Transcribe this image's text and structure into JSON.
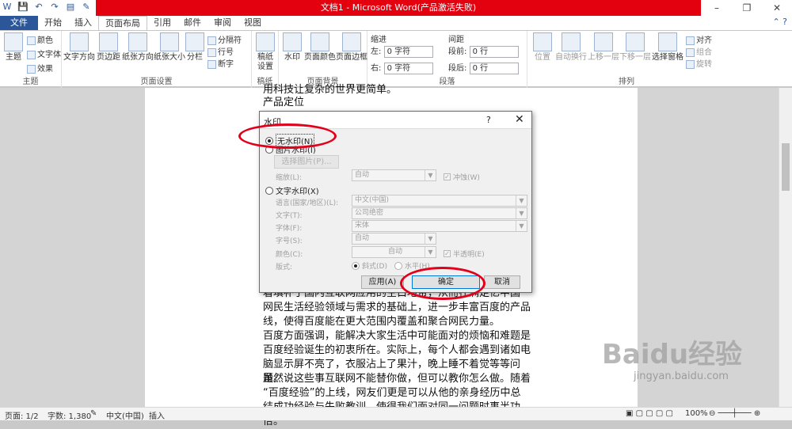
{
  "window": {
    "title": "文档1 - Microsoft Word(产品激活失败)"
  },
  "tabs": [
    "文件",
    "开始",
    "插入",
    "页面布局",
    "引用",
    "邮件",
    "审阅",
    "视图"
  ],
  "ribbon": {
    "theme": {
      "big": "主题",
      "colors": "颜色",
      "fonts": "文字体",
      "effects": "效果",
      "label": "主题"
    },
    "page_setup": {
      "buttons": [
        "文字方向",
        "页边距",
        "纸张方向",
        "纸张大小",
        "分栏"
      ],
      "breaks": "分隔符",
      "line_numbers": "行号",
      "hyphenation": "断字",
      "label": "页面设置"
    },
    "manuscript": {
      "button": "稿纸\n设置",
      "label": "稿纸"
    },
    "page_background": {
      "buttons": [
        "水印",
        "页面颜色",
        "页面边框"
      ],
      "label": "页面背景"
    },
    "paragraph": {
      "indent": "缩进",
      "spacing": "间距",
      "left": "左:",
      "right": "右:",
      "before": "段前:",
      "after": "段后:",
      "left_val": "0 字符",
      "right_val": "0 字符",
      "before_val": "0 行",
      "after_val": "0 行",
      "label": "段落"
    },
    "arrange": {
      "buttons": [
        "位置",
        "自动换行",
        "上移一层",
        "下移一层",
        "选择窗格"
      ],
      "align": "对齐",
      "group": "组合",
      "rotate": "旋转",
      "label": "排列"
    }
  },
  "document": {
    "top_lines": [
      "用科技让复杂的世界更简单。",
      "产品定位"
    ],
    "bottom_lines": [
      "着填补了国内互联网应用的空白地带，从而在满足亿中国",
      "网民生活经验领域与需求的基础上，进一步丰富百度的产品",
      "线，使得百度能在更大范围内覆盖和聚合网民力量。",
      "百度方面强调，能解决大家生活中可能面对的烦恼和难题是",
      "百度经验诞生的初衷所在。实际上，每个人都会遇到诸如电",
      "脑显示屏不亮了，衣服沾上了果汁，晚上睡不着觉等等问题。",
      "虽然说这些事互联网不能替你做，但可以教你怎么做。随着",
      "“百度经验”的上线，网友们更是可以从他的亲身经历中总",
      "结成功经验与失败教训，使得我们面对同一问题时事半功倍。"
    ]
  },
  "dialog": {
    "title": "水印",
    "help": "?",
    "close": "✕",
    "no_watermark": "无水印(N)",
    "picture_watermark": "图片水印(I)",
    "select_picture": "选择图片(P)...",
    "scale_label": "缩放(L):",
    "scale_value": "自动",
    "washout": "冲蚀(W)",
    "text_watermark": "文字水印(X)",
    "language_label": "语言(国家/地区)(L):",
    "language_value": "中文(中国)",
    "text_label": "文字(T):",
    "text_value": "公司绝密",
    "font_label": "字体(F):",
    "font_value": "宋体",
    "size_label": "字号(S):",
    "size_value": "自动",
    "color_label": "颜色(C):",
    "color_value": "自动",
    "semitransparent": "半透明(E)",
    "layout_label": "版式:",
    "diagonal": "斜式(D)",
    "horizontal": "水平(H)",
    "apply": "应用(A)",
    "ok": "确定",
    "cancel": "取消"
  },
  "status": {
    "page": "页面: 1/2",
    "words": "字数: 1,380",
    "language": "中文(中国)",
    "mode": "插入",
    "zoom": "100%"
  },
  "brand_watermark": {
    "logo": "Baidu经验",
    "url": "jingyan.baidu.com"
  },
  "colors": {
    "file_tab": "#2b579a",
    "title_bar": "#e3000f",
    "annotation": "#e2001a"
  }
}
